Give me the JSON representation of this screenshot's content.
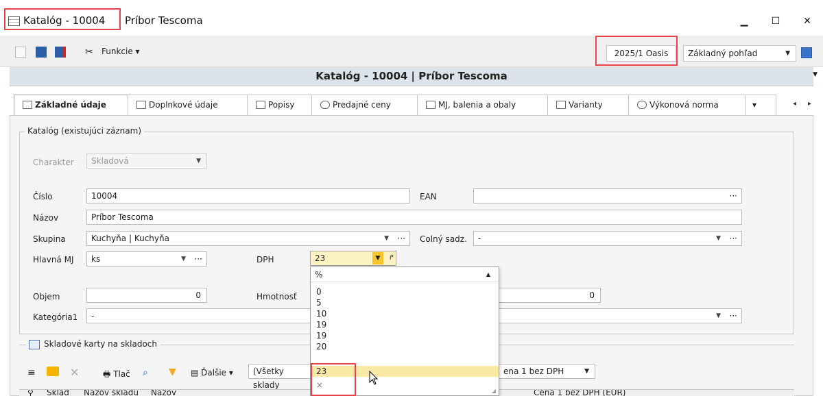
{
  "window": {
    "title_main": "Katalóg - 10004",
    "title_sub": "Príbor Tescoma",
    "minimize": "▁",
    "maximize": "☐",
    "close": "✕"
  },
  "toolbar": {
    "funkcie_label": "Funkcie",
    "period": "2025/1 Oasis",
    "view": "Základný pohľad"
  },
  "header": {
    "title": "Katalóg - 10004 | Príbor Tescoma"
  },
  "tabs": [
    {
      "label": "Základné údaje"
    },
    {
      "label": "Doplnkové údaje"
    },
    {
      "label": "Popisy"
    },
    {
      "label": "Predajné ceny"
    },
    {
      "label": "MJ, balenia a obaly"
    },
    {
      "label": "Varianty"
    },
    {
      "label": "Výkonová norma"
    }
  ],
  "form": {
    "group_title": "Katalóg (existujúci záznam)",
    "charakter_label": "Charakter",
    "charakter_value": "Skladová",
    "cislo_label": "Číslo",
    "cislo_value": "10004",
    "ean_label": "EAN",
    "nazov_label": "Názov",
    "nazov_value": "Príbor Tescoma",
    "skupina_label": "Skupina",
    "skupina_value": "Kuchyňa | Kuchyňa",
    "colny_label": "Colný sadz.",
    "colny_value": "-",
    "hlavna_mj_label": "Hlavná MJ",
    "hlavna_mj_value": "ks",
    "dph_label": "DPH",
    "dph_value": "23",
    "objem_label": "Objem",
    "objem_value": "0",
    "hmotnost_label": "Hmotnosť",
    "hmotnost_value": "0",
    "kategoria_label": "Kategória1",
    "kategoria_value": "-",
    "ellipsis": "···"
  },
  "dropdown": {
    "header": "%",
    "options": [
      "0",
      "5",
      "10",
      "19",
      "19",
      "20",
      "23"
    ],
    "selected": "23",
    "clear": "×"
  },
  "sklad": {
    "group_title": "Skladové karty na skladoch",
    "tlac": "Tlač",
    "dalsie": "Ďalšie",
    "filter": "(Všetky sklady",
    "cena_select": "ena 1 bez DPH",
    "col_sklad": "Sklad",
    "col_nazov_skladu": "Názov skladu",
    "col_nazov": "Názov",
    "col_cena": "Cena 1 bez DPH (EUR)"
  }
}
